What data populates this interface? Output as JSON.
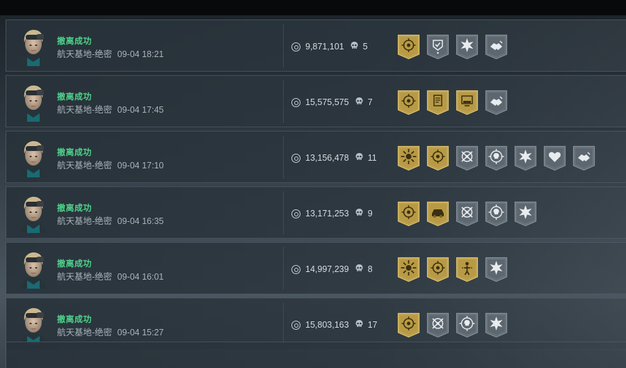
{
  "colors": {
    "success": "#4fd18b",
    "badge_gold": "#b89a45",
    "badge_gray": "#5d6770",
    "text_primary": "#d7dde1",
    "text_secondary": "#a8b3ba"
  },
  "rows": [
    {
      "status": "撤离成功",
      "location": "航天基地-绝密",
      "time": "09-04 18:21",
      "value": "9,871,101",
      "kills": "5",
      "badges": [
        {
          "icon": "crosshair-medal-icon",
          "tier": "gold"
        },
        {
          "icon": "shield-check-icon",
          "tier": "gray"
        },
        {
          "icon": "burst-star-icon",
          "tier": "gray"
        },
        {
          "icon": "handshake-icon",
          "tier": "gray"
        }
      ]
    },
    {
      "status": "撤离成功",
      "location": "航天基地-绝密",
      "time": "09-04 17:45",
      "value": "15,575,575",
      "kills": "7",
      "badges": [
        {
          "icon": "crosshair-medal-icon",
          "tier": "gold"
        },
        {
          "icon": "document-icon",
          "tier": "gold"
        },
        {
          "icon": "monitor-icon",
          "tier": "gold"
        },
        {
          "icon": "handshake-icon",
          "tier": "gray"
        }
      ]
    },
    {
      "status": "撤离成功",
      "location": "航天基地-绝密",
      "time": "09-04 17:10",
      "value": "13,156,478",
      "kills": "11",
      "badges": [
        {
          "icon": "sun-burst-icon",
          "tier": "gold"
        },
        {
          "icon": "crosshair-medal-icon",
          "tier": "gold"
        },
        {
          "icon": "crossed-target-icon",
          "tier": "gray"
        },
        {
          "icon": "skull-target-icon",
          "tier": "gray"
        },
        {
          "icon": "burst-star-icon",
          "tier": "gray"
        },
        {
          "icon": "heart-icon",
          "tier": "gray"
        },
        {
          "icon": "handshake-icon",
          "tier": "gray"
        }
      ]
    },
    {
      "status": "撤离成功",
      "location": "航天基地-绝密",
      "time": "09-04 16:35",
      "value": "13,171,253",
      "kills": "9",
      "badges": [
        {
          "icon": "crosshair-medal-icon",
          "tier": "gold"
        },
        {
          "icon": "vehicle-icon",
          "tier": "gold"
        },
        {
          "icon": "crossed-target-icon",
          "tier": "gray"
        },
        {
          "icon": "skull-target-icon",
          "tier": "gray"
        },
        {
          "icon": "burst-star-icon",
          "tier": "gray"
        }
      ]
    },
    {
      "status": "撤离成功",
      "location": "航天基地-绝密",
      "time": "09-04 16:01",
      "value": "14,997,239",
      "kills": "8",
      "badges": [
        {
          "icon": "sun-burst-icon",
          "tier": "gold"
        },
        {
          "icon": "crosshair-medal-icon",
          "tier": "gold"
        },
        {
          "icon": "figure-target-icon",
          "tier": "gold"
        },
        {
          "icon": "burst-star-icon",
          "tier": "gray"
        }
      ]
    },
    {
      "status": "撤离成功",
      "location": "航天基地-绝密",
      "time": "09-04 15:27",
      "value": "15,803,163",
      "kills": "17",
      "badges": [
        {
          "icon": "crosshair-medal-icon",
          "tier": "gold"
        },
        {
          "icon": "crossed-target-icon",
          "tier": "gray"
        },
        {
          "icon": "skull-target-icon",
          "tier": "gray"
        },
        {
          "icon": "burst-star-icon",
          "tier": "gray"
        }
      ]
    }
  ]
}
